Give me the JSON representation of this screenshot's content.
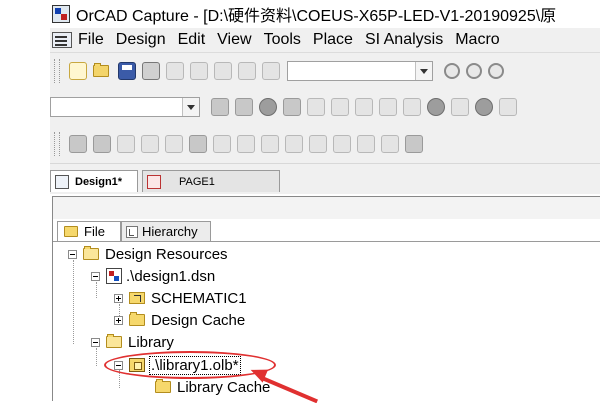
{
  "window": {
    "title": "OrCAD Capture - [D:\\硬件资料\\COEUS-X65P-LED-V1-20190925\\原"
  },
  "menu": {
    "items": [
      "File",
      "Design",
      "Edit",
      "View",
      "Tools",
      "Place",
      "SI Analysis",
      "Macro"
    ]
  },
  "toolbar1": {
    "icons": [
      "new-icon",
      "open-icon",
      "save-icon",
      "print-icon",
      "cut-icon",
      "copy-icon",
      "paste-icon",
      "undo-icon",
      "redo-icon",
      "zoom-in-icon",
      "zoom-out-icon",
      "zoom-area-icon"
    ],
    "search_value": ""
  },
  "toolbar2": {
    "combo_value": "",
    "icons": [
      "design-rules-icon",
      "netlist-icon",
      "run-icon",
      "annotate-icon",
      "probe-icon",
      "probe-multi-icon",
      "voltage-probe-icon",
      "current-probe-icon",
      "power-probe-icon",
      "marker-v-icon",
      "marker-i-icon",
      "marker-p-icon"
    ]
  },
  "toolbar3": {
    "icons": [
      "part-icon",
      "wire-icon",
      "net-alias-icon",
      "bus-icon",
      "junction-icon",
      "bus-entry-icon",
      "power-icon",
      "ground-icon",
      "off-page-icon",
      "hier-block-icon",
      "hier-port-icon",
      "hier-pin-icon",
      "no-connect-icon",
      "text-icon",
      "table-icon"
    ]
  },
  "doc_tabs": [
    {
      "label": "Design1*",
      "active": true
    },
    {
      "label": "PAGE1",
      "active": false
    }
  ],
  "project_tabs": [
    {
      "label": "File",
      "active": true
    },
    {
      "label": "Hierarchy",
      "active": false
    }
  ],
  "tree": {
    "design_resources": "Design Resources",
    "design_file": ".\\design1.dsn",
    "schematic": "SCHEMATIC1",
    "design_cache": "Design Cache",
    "library": "Library",
    "library_file": ".\\library1.olb*",
    "library_cache": "Library Cache"
  },
  "annotation": {
    "color": "#e03030"
  }
}
